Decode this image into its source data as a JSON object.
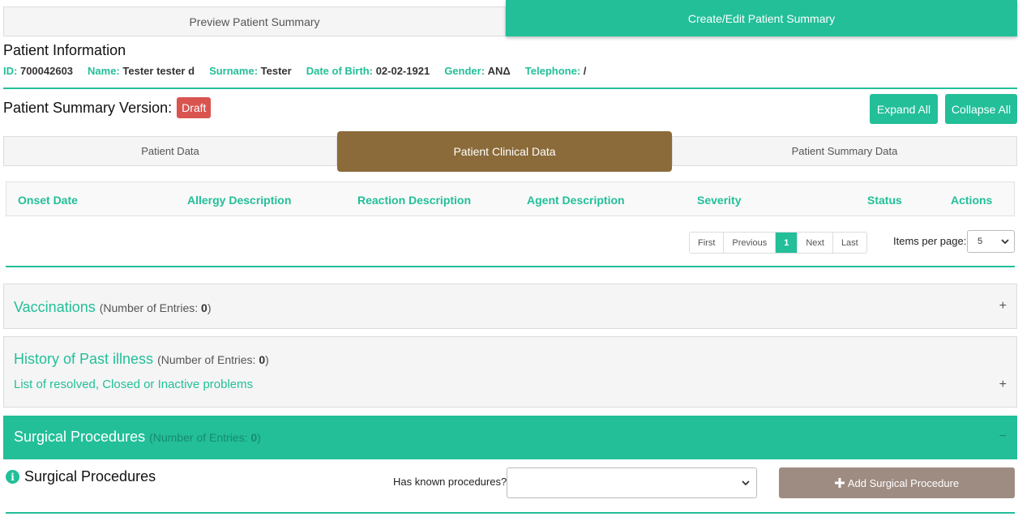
{
  "top_tabs": {
    "preview": "Preview Patient Summary",
    "create": "Create/Edit Patient Summary"
  },
  "patient_info": {
    "title": "Patient Information",
    "fields": [
      {
        "label": "ID:",
        "value": "700042603"
      },
      {
        "label": "Name:",
        "value": "Tester tester d"
      },
      {
        "label": "Surname:",
        "value": "Tester"
      },
      {
        "label": "Date of Birth:",
        "value": "02-02-1921"
      },
      {
        "label": "Gender:",
        "value": "ΑΝΔ"
      },
      {
        "label": "Telephone:",
        "value": "/"
      }
    ]
  },
  "version": {
    "label": "Patient Summary Version:",
    "badge": "Draft"
  },
  "buttons": {
    "expand_all": "Expand All",
    "collapse_all": "Collapse All"
  },
  "mid_tabs": {
    "patient_data": "Patient Data",
    "clinical_data": "Patient Clinical Data",
    "summary_data": "Patient Summary Data"
  },
  "allergy_table": {
    "columns": [
      "Onset Date",
      "Allergy Description",
      "Reaction Description",
      "Agent Description",
      "Severity",
      "Status",
      "Actions"
    ]
  },
  "pagination": {
    "first": "First",
    "previous": "Previous",
    "current": "1",
    "next": "Next",
    "last": "Last",
    "items_per_page_label": "Items per page:",
    "items_per_page_value": "5"
  },
  "panels": {
    "vaccinations": {
      "title": "Vaccinations",
      "count_label": "(Number of Entries:",
      "count": "0",
      "count_close": ")",
      "toggle": "+"
    },
    "past_illness": {
      "title": "History of Past illness",
      "count_label": "(Number of Entries:",
      "count": "0",
      "count_close": ")",
      "subtitle": "List of resolved, Closed or Inactive problems",
      "toggle": "+"
    },
    "surgical": {
      "title": "Surgical Procedures",
      "count_label": "(Number of Entries:",
      "count": "0",
      "count_close": ")",
      "toggle": "−"
    }
  },
  "surgical_section": {
    "heading": "Surgical Procedures",
    "has_known_label": "Has known procedures?",
    "has_known_value": "",
    "add_button": "Add Surgical Procedure"
  },
  "colors": {
    "accent": "#22bf99",
    "active_tab": "#8b6b3a",
    "draft": "#d9534f",
    "add_button": "#9e8c82"
  }
}
